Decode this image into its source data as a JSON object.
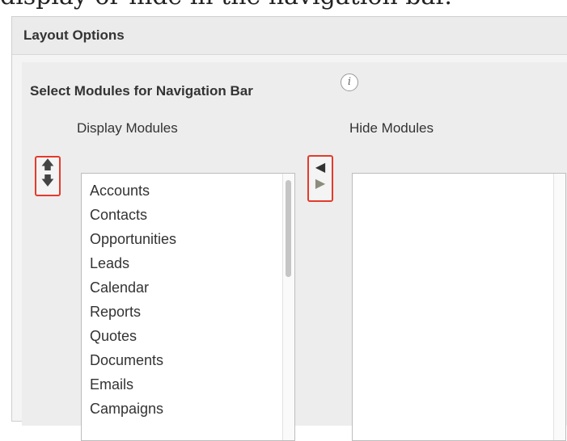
{
  "doc_caption": "display or hide in the navigation bar.",
  "panel": {
    "header_title": "Layout Options",
    "section_title": "Select Modules for Navigation Bar",
    "info_icon_glyph": "i"
  },
  "display_modules": {
    "label": "Display Modules",
    "items": [
      "Accounts",
      "Contacts",
      "Opportunities",
      "Leads",
      "Calendar",
      "Reports",
      "Quotes",
      "Documents",
      "Emails",
      "Campaigns"
    ]
  },
  "hide_modules": {
    "label": "Hide Modules",
    "items": []
  },
  "reorder_controls": {
    "move_up_icon": "arrow-up-icon",
    "move_down_icon": "arrow-down-icon",
    "move_up_glyph": "🡅",
    "move_down_glyph": "🡇"
  },
  "transfer_controls": {
    "move_left_icon": "triangle-left-icon",
    "move_right_icon": "triangle-right-icon",
    "move_left_glyph": "◀",
    "move_right_glyph": "▶"
  },
  "colors": {
    "highlight": "#e53a2c",
    "panel_bg": "#ededed",
    "list_bg": "#ffffff"
  }
}
